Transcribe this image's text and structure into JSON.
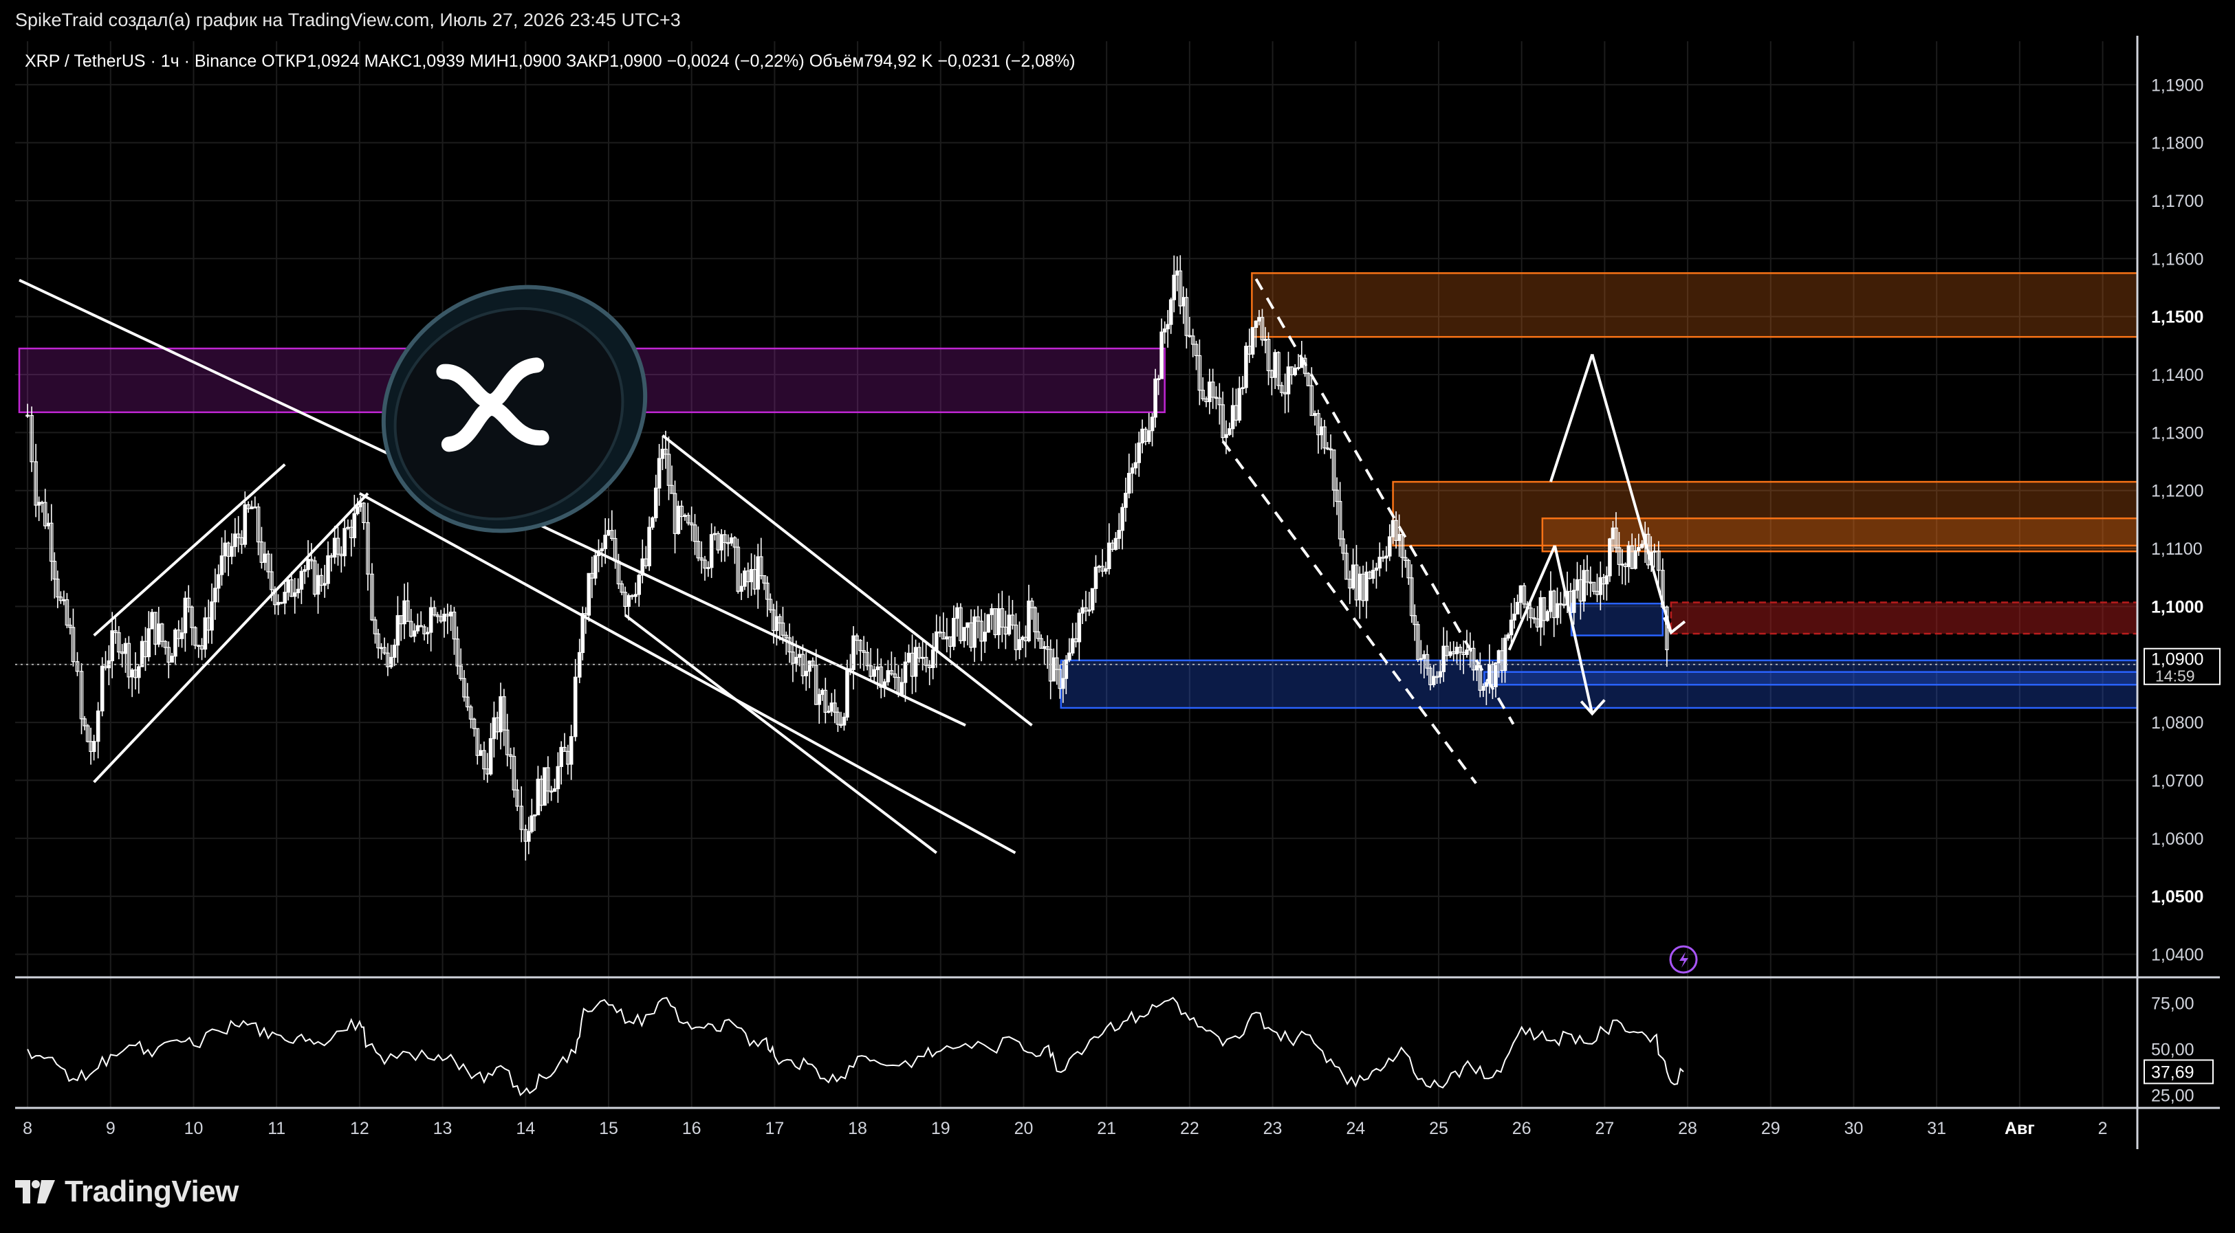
{
  "attribution": "SpikeTraid создал(а) график на TradingView.com, Июль 27, 2026 23:45 UTC+3",
  "legend": {
    "symbol": "XRP / TetherUS · 1ч · Binance",
    "open_label": "ОТКР",
    "open": "1,0924",
    "high_label": "МАКС",
    "high": "1,0939",
    "low_label": "МИН",
    "low": "1,0900",
    "close_label": "ЗАКР",
    "close": "1,0900",
    "change": "−0,0024 (−0,22%)",
    "volume_label": "Объём",
    "volume": "794,92 K",
    "volume_change": "−0,0231 (−2,08%)"
  },
  "last_price": {
    "value": "1,0900",
    "countdown": "14:59"
  },
  "rsi_last": "37,69",
  "brand": "TradingView",
  "colors": {
    "background": "#000000",
    "grid": "#1c1c1c",
    "candle": "#ffffff",
    "magenta_zone": "#c026d3",
    "orange_zone": "#f97316",
    "blue_zone": "#2962ff",
    "red_zone": "#b91c1c",
    "last_price_badge": "#ffffff"
  },
  "chart_data": [
    {
      "type": "candlestick",
      "title": "XRP / TetherUS · 1ч · Binance",
      "x_ticks": [
        "8",
        "9",
        "10",
        "11",
        "12",
        "13",
        "14",
        "15",
        "16",
        "17",
        "18",
        "19",
        "20",
        "21",
        "22",
        "23",
        "24",
        "25",
        "26",
        "27",
        "28",
        "29",
        "30",
        "31",
        "Авг",
        "2"
      ],
      "y_ticks": [
        "1,1900",
        "1,1800",
        "1,1700",
        "1,1600",
        "1,1500",
        "1,1400",
        "1,1300",
        "1,1200",
        "1,1100",
        "1,1000",
        "1,0900",
        "1,0800",
        "1,0700",
        "1,0600",
        "1,0500",
        "1,0400"
      ],
      "y_bold_ticks": [
        "1,1500",
        "1,1000",
        "1,0500"
      ],
      "ylim": [
        1.0365,
        1.1975
      ],
      "xlim_days": [
        7.9,
        33.6
      ],
      "grid": true,
      "price_path": [
        [
          8.0,
          1.133
        ],
        [
          8.1,
          1.12
        ],
        [
          8.25,
          1.114
        ],
        [
          8.4,
          1.1
        ],
        [
          8.55,
          1.093
        ],
        [
          8.65,
          1.08
        ],
        [
          8.8,
          1.074
        ],
        [
          8.9,
          1.09
        ],
        [
          9.1,
          1.095
        ],
        [
          9.3,
          1.088
        ],
        [
          9.5,
          1.097
        ],
        [
          9.7,
          1.092
        ],
        [
          9.9,
          1.1
        ],
        [
          10.1,
          1.093
        ],
        [
          10.3,
          1.106
        ],
        [
          10.5,
          1.111
        ],
        [
          10.7,
          1.117
        ],
        [
          10.9,
          1.104
        ],
        [
          11.1,
          1.101
        ],
        [
          11.3,
          1.107
        ],
        [
          11.5,
          1.104
        ],
        [
          11.7,
          1.109
        ],
        [
          11.9,
          1.114
        ],
        [
          12.05,
          1.116
        ],
        [
          12.15,
          1.097
        ],
        [
          12.3,
          1.091
        ],
        [
          12.5,
          1.099
        ],
        [
          12.7,
          1.094
        ],
        [
          12.9,
          1.101
        ],
        [
          13.1,
          1.098
        ],
        [
          13.3,
          1.081
        ],
        [
          13.5,
          1.072
        ],
        [
          13.7,
          1.082
        ],
        [
          13.9,
          1.068
        ],
        [
          14.0,
          1.061
        ],
        [
          14.15,
          1.068
        ],
        [
          14.35,
          1.071
        ],
        [
          14.55,
          1.076
        ],
        [
          14.65,
          1.094
        ],
        [
          14.8,
          1.106
        ],
        [
          15.0,
          1.112
        ],
        [
          15.2,
          1.102
        ],
        [
          15.45,
          1.107
        ],
        [
          15.65,
          1.128
        ],
        [
          15.8,
          1.115
        ],
        [
          16.0,
          1.112
        ],
        [
          16.2,
          1.109
        ],
        [
          16.4,
          1.114
        ],
        [
          16.6,
          1.103
        ],
        [
          16.8,
          1.106
        ],
        [
          16.95,
          1.099
        ],
        [
          17.1,
          1.095
        ],
        [
          17.3,
          1.091
        ],
        [
          17.5,
          1.086
        ],
        [
          17.65,
          1.082
        ],
        [
          17.8,
          1.081
        ],
        [
          17.95,
          1.092
        ],
        [
          18.2,
          1.09
        ],
        [
          18.45,
          1.087
        ],
        [
          18.7,
          1.091
        ],
        [
          18.95,
          1.093
        ],
        [
          19.2,
          1.097
        ],
        [
          19.45,
          1.095
        ],
        [
          19.7,
          1.098
        ],
        [
          19.95,
          1.094
        ],
        [
          20.1,
          1.1
        ],
        [
          20.25,
          1.092
        ],
        [
          20.4,
          1.087
        ],
        [
          20.55,
          1.091
        ],
        [
          20.75,
          1.1
        ],
        [
          20.95,
          1.108
        ],
        [
          21.15,
          1.115
        ],
        [
          21.35,
          1.125
        ],
        [
          21.55,
          1.135
        ],
        [
          21.7,
          1.148
        ],
        [
          21.85,
          1.158
        ],
        [
          22.0,
          1.145
        ],
        [
          22.2,
          1.137
        ],
        [
          22.4,
          1.131
        ],
        [
          22.6,
          1.136
        ],
        [
          22.8,
          1.152
        ],
        [
          22.95,
          1.143
        ],
        [
          23.15,
          1.138
        ],
        [
          23.35,
          1.14
        ],
        [
          23.55,
          1.131
        ],
        [
          23.7,
          1.126
        ],
        [
          23.85,
          1.108
        ],
        [
          24.05,
          1.103
        ],
        [
          24.25,
          1.108
        ],
        [
          24.45,
          1.113
        ],
        [
          24.6,
          1.108
        ],
        [
          24.75,
          1.093
        ],
        [
          24.9,
          1.087
        ],
        [
          25.1,
          1.091
        ],
        [
          25.3,
          1.094
        ],
        [
          25.5,
          1.088
        ],
        [
          25.65,
          1.089
        ],
        [
          25.8,
          1.092
        ],
        [
          25.95,
          1.101
        ],
        [
          26.15,
          1.099
        ],
        [
          26.35,
          1.101
        ],
        [
          26.55,
          1.1
        ],
        [
          26.75,
          1.104
        ],
        [
          26.95,
          1.104
        ],
        [
          27.1,
          1.112
        ],
        [
          27.25,
          1.107
        ],
        [
          27.45,
          1.111
        ],
        [
          27.6,
          1.109
        ],
        [
          27.7,
          1.1
        ],
        [
          27.8,
          1.09
        ]
      ],
      "zones": [
        {
          "kind": "magenta",
          "from_day": 7.9,
          "to_day": 21.7,
          "low": 1.1335,
          "high": 1.1445
        },
        {
          "kind": "orange",
          "from_day": 22.75,
          "to_day": 33.5,
          "low": 1.1465,
          "high": 1.1575
        },
        {
          "kind": "orange",
          "from_day": 24.45,
          "to_day": 33.5,
          "low": 1.1105,
          "high": 1.1215
        },
        {
          "kind": "orange",
          "from_day": 26.25,
          "to_day": 33.5,
          "low": 1.1095,
          "high": 1.1152
        },
        {
          "kind": "red",
          "from_day": 27.8,
          "to_day": 33.5,
          "low": 1.0953,
          "high": 1.1007
        },
        {
          "kind": "blue",
          "from_day": 26.6,
          "to_day": 27.7,
          "low": 1.095,
          "high": 1.1005
        },
        {
          "kind": "blue",
          "from_day": 20.45,
          "to_day": 33.5,
          "low": 1.0825,
          "high": 1.0907
        },
        {
          "kind": "blue",
          "from_day": 25.55,
          "to_day": 33.5,
          "low": 1.0865,
          "high": 1.0887
        }
      ],
      "trend_lines": [
        {
          "style": "solid",
          "from": [
            7.9,
            1.1563
          ],
          "to": [
            19.3,
            1.0795
          ]
        },
        {
          "style": "solid",
          "from": [
            8.8,
            1.0697
          ],
          "to": [
            12.1,
            1.1195
          ]
        },
        {
          "style": "solid",
          "from": [
            8.8,
            1.095
          ],
          "to": [
            11.1,
            1.1245
          ]
        },
        {
          "style": "solid",
          "from": [
            15.65,
            1.1295
          ],
          "to": [
            20.1,
            1.0795
          ]
        },
        {
          "style": "solid",
          "from": [
            15.2,
            1.0985
          ],
          "to": [
            18.95,
            1.0575
          ]
        },
        {
          "style": "solid",
          "from": [
            12.0,
            1.1195
          ],
          "to": [
            19.9,
            1.0575
          ]
        },
        {
          "style": "dashed",
          "from": [
            22.8,
            1.1565
          ],
          "to": [
            25.9,
            1.0797
          ]
        },
        {
          "style": "dashed",
          "from": [
            22.4,
            1.1285
          ],
          "to": [
            25.45,
            1.0695
          ]
        },
        {
          "style": "solid",
          "from": [
            26.35,
            1.1215
          ],
          "to": [
            26.85,
            1.1435
          ]
        },
        {
          "style": "solid",
          "from": [
            26.85,
            1.1435
          ],
          "to": [
            27.8,
            1.0955
          ]
        },
        {
          "style": "solid",
          "from": [
            25.85,
            1.0925
          ],
          "to": [
            26.4,
            1.1105
          ]
        },
        {
          "style": "solid",
          "from": [
            26.4,
            1.1105
          ],
          "to": [
            26.85,
            1.0815
          ]
        }
      ],
      "last_price_line": 1.09
    },
    {
      "type": "line",
      "title": "RSI",
      "y_ticks": [
        "75,00",
        "50,00",
        "25,00"
      ],
      "ylim": [
        18,
        88
      ],
      "last_value": 37.69,
      "path": [
        [
          8.0,
          50
        ],
        [
          8.2,
          45
        ],
        [
          8.4,
          40
        ],
        [
          8.6,
          33
        ],
        [
          8.8,
          38
        ],
        [
          9.0,
          47
        ],
        [
          9.3,
          52
        ],
        [
          9.5,
          46
        ],
        [
          9.8,
          55
        ],
        [
          10.0,
          52
        ],
        [
          10.3,
          60
        ],
        [
          10.5,
          63
        ],
        [
          10.7,
          64
        ],
        [
          10.9,
          56
        ],
        [
          11.1,
          55
        ],
        [
          11.3,
          58
        ],
        [
          11.5,
          54
        ],
        [
          11.8,
          60
        ],
        [
          12.0,
          65
        ],
        [
          12.1,
          52
        ],
        [
          12.3,
          42
        ],
        [
          12.6,
          48
        ],
        [
          12.9,
          44
        ],
        [
          13.1,
          47
        ],
        [
          13.3,
          38
        ],
        [
          13.5,
          32
        ],
        [
          13.7,
          41
        ],
        [
          13.9,
          30
        ],
        [
          14.05,
          26
        ],
        [
          14.2,
          35
        ],
        [
          14.4,
          42
        ],
        [
          14.6,
          48
        ],
        [
          14.7,
          72
        ],
        [
          14.9,
          76
        ],
        [
          15.1,
          70
        ],
        [
          15.3,
          64
        ],
        [
          15.5,
          69
        ],
        [
          15.7,
          78
        ],
        [
          15.9,
          64
        ],
        [
          16.1,
          62
        ],
        [
          16.3,
          60
        ],
        [
          16.5,
          64
        ],
        [
          16.7,
          52
        ],
        [
          16.9,
          56
        ],
        [
          17.0,
          46
        ],
        [
          17.2,
          44
        ],
        [
          17.4,
          42
        ],
        [
          17.6,
          34
        ],
        [
          17.8,
          35
        ],
        [
          18.0,
          46
        ],
        [
          18.2,
          44
        ],
        [
          18.5,
          41
        ],
        [
          18.8,
          46
        ],
        [
          19.0,
          49
        ],
        [
          19.3,
          53
        ],
        [
          19.6,
          50
        ],
        [
          19.9,
          55
        ],
        [
          20.1,
          48
        ],
        [
          20.3,
          52
        ],
        [
          20.4,
          38
        ],
        [
          20.6,
          47
        ],
        [
          20.8,
          55
        ],
        [
          21.0,
          62
        ],
        [
          21.2,
          65
        ],
        [
          21.4,
          68
        ],
        [
          21.6,
          73
        ],
        [
          21.8,
          78
        ],
        [
          22.0,
          66
        ],
        [
          22.2,
          60
        ],
        [
          22.4,
          52
        ],
        [
          22.6,
          56
        ],
        [
          22.8,
          70
        ],
        [
          23.0,
          60
        ],
        [
          23.2,
          55
        ],
        [
          23.4,
          58
        ],
        [
          23.6,
          49
        ],
        [
          23.8,
          40
        ],
        [
          24.0,
          30
        ],
        [
          24.2,
          38
        ],
        [
          24.4,
          45
        ],
        [
          24.6,
          48
        ],
        [
          24.8,
          34
        ],
        [
          25.0,
          30
        ],
        [
          25.2,
          38
        ],
        [
          25.4,
          40
        ],
        [
          25.6,
          34
        ],
        [
          25.8,
          44
        ],
        [
          26.0,
          62
        ],
        [
          26.2,
          57
        ],
        [
          26.4,
          55
        ],
        [
          26.6,
          58
        ],
        [
          26.8,
          53
        ],
        [
          27.0,
          60
        ],
        [
          27.2,
          64
        ],
        [
          27.4,
          59
        ],
        [
          27.6,
          57
        ],
        [
          27.7,
          45
        ],
        [
          27.8,
          32
        ],
        [
          27.95,
          37.69
        ]
      ]
    }
  ]
}
